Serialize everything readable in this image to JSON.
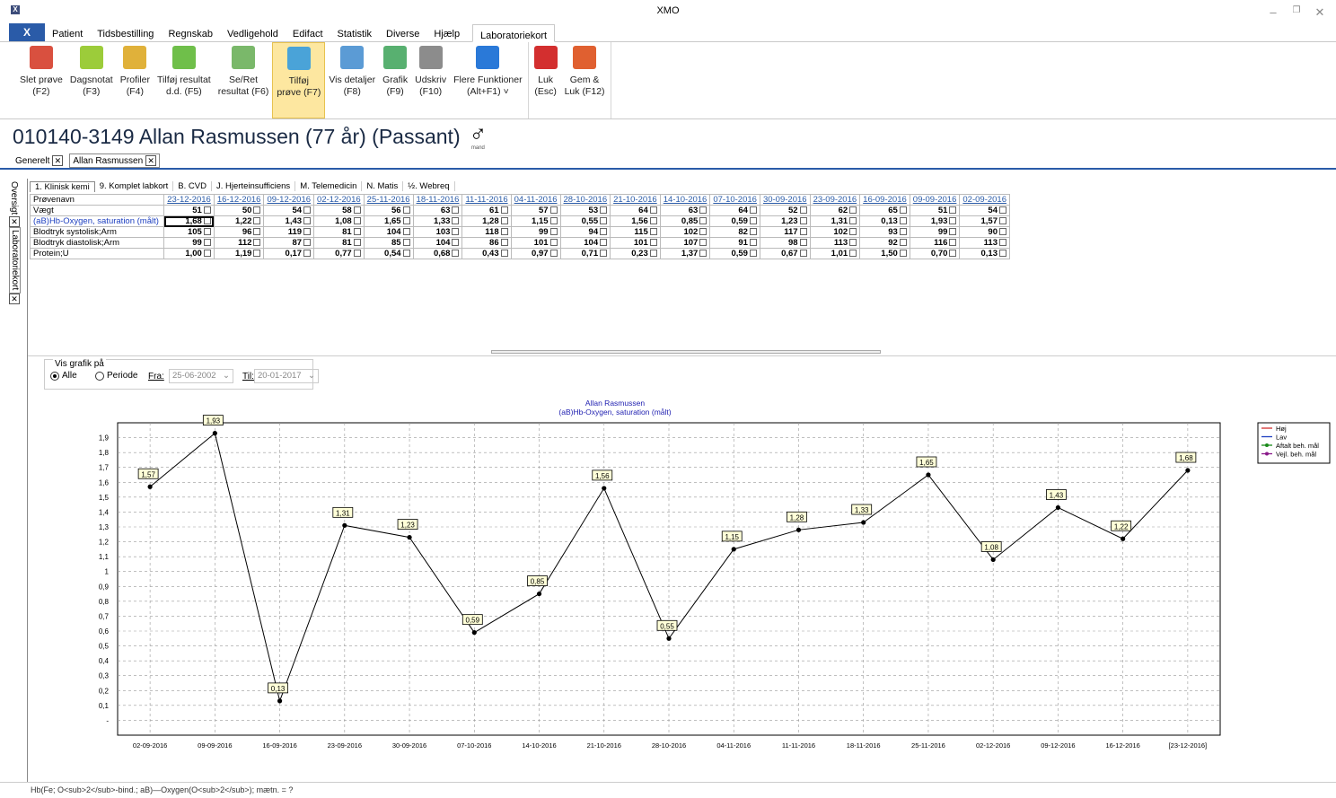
{
  "app": {
    "title": "XMO",
    "icon_letter": "X"
  },
  "menu": {
    "file_label": "X",
    "tabs": [
      "Patient",
      "Tidsbestilling",
      "Regnskab",
      "Vedligehold",
      "Edifact",
      "Statistik",
      "Diverse",
      "Hjælp"
    ],
    "active_tab": "Laboratoriekort"
  },
  "ribbon": {
    "buttons": [
      {
        "l1": "Slet prøve",
        "l2": "(F2)",
        "icon": "erase-icon",
        "color": "#d9503f"
      },
      {
        "l1": "Dagsnotat",
        "l2": "(F3)",
        "icon": "pencil-icon",
        "color": "#9ccc3a"
      },
      {
        "l1": "Profiler",
        "l2": "(F4)",
        "icon": "flask-icon",
        "color": "#e0b13a"
      },
      {
        "l1": "Tilføj resultat",
        "l2": "d.d. (F5)",
        "icon": "add-table-icon",
        "color": "#6fbf4a"
      },
      {
        "l1": "Se/Ret",
        "l2": "resultat (F6)",
        "icon": "edit-icon",
        "color": "#7ab86a"
      },
      {
        "l1": "Tilføj",
        "l2": "prøve (F7)",
        "icon": "add-sample-icon",
        "color": "#4aa3d8",
        "active": true
      },
      {
        "l1": "Vis detaljer",
        "l2": "(F8)",
        "icon": "magnifier-icon",
        "color": "#5b9bd5"
      },
      {
        "l1": "Grafik",
        "l2": "(F9)",
        "icon": "picture-icon",
        "color": "#58b070"
      },
      {
        "l1": "Udskriv",
        "l2": "(F10)",
        "icon": "printer-icon",
        "color": "#8c8c8c"
      },
      {
        "l1": "Flere Funktioner",
        "l2": "(Alt+F1) ˅",
        "icon": "fast-forward-icon",
        "color": "#2a79d8"
      }
    ],
    "close_buttons": [
      {
        "l1": "Luk",
        "l2": "(Esc)",
        "icon": "close-icon",
        "color": "#d32f2f"
      },
      {
        "l1": "Gem &",
        "l2": "Luk (F12)",
        "icon": "save-close-icon",
        "color": "#e06030"
      }
    ]
  },
  "patient": {
    "header": "010140-3149 Allan Rasmussen (77 år) (Passant)",
    "gender_symbol": "♂",
    "gender_label": "mand"
  },
  "doc_tabs": [
    "Generelt",
    "Allan Rasmussen"
  ],
  "left_rail": [
    "Oversigt",
    "Laboratoriekort"
  ],
  "sub_tabs": [
    "1. Klinisk kemi",
    "9. Komplet labkort",
    "B. CVD",
    "J. Hjerteinsufficiens",
    "M. Telemedicin",
    "N. Matis",
    "½. Webreq"
  ],
  "grid": {
    "name_header": "Prøvenavn",
    "dates": [
      "23-12-2016",
      "16-12-2016",
      "09-12-2016",
      "02-12-2016",
      "25-11-2016",
      "18-11-2016",
      "11-11-2016",
      "04-11-2016",
      "28-10-2016",
      "21-10-2016",
      "14-10-2016",
      "07-10-2016",
      "30-09-2016",
      "23-09-2016",
      "16-09-2016",
      "09-09-2016",
      "02-09-2016"
    ],
    "rows": [
      {
        "name": "Vægt",
        "values": [
          "51",
          "50",
          "54",
          "58",
          "56",
          "63",
          "61",
          "57",
          "53",
          "64",
          "63",
          "64",
          "52",
          "62",
          "65",
          "51",
          "54"
        ]
      },
      {
        "name": "(aB)Hb-Oxygen, saturation (målt)",
        "link": true,
        "values": [
          "1,68",
          "1,22",
          "1,43",
          "1,08",
          "1,65",
          "1,33",
          "1,28",
          "1,15",
          "0,55",
          "1,56",
          "0,85",
          "0,59",
          "1,23",
          "1,31",
          "0,13",
          "1,93",
          "1,57"
        ]
      },
      {
        "name": "Blodtryk systolisk;Arm",
        "values": [
          "105",
          "96",
          "119",
          "81",
          "104",
          "103",
          "118",
          "99",
          "94",
          "115",
          "102",
          "82",
          "117",
          "102",
          "93",
          "99",
          "90"
        ]
      },
      {
        "name": "Blodtryk diastolisk;Arm",
        "values": [
          "99",
          "112",
          "87",
          "81",
          "85",
          "104",
          "86",
          "101",
          "104",
          "101",
          "107",
          "91",
          "98",
          "113",
          "92",
          "116",
          "113"
        ]
      },
      {
        "name": "Protein;U",
        "values": [
          "1,00",
          "1,19",
          "0,17",
          "0,77",
          "0,54",
          "0,68",
          "0,43",
          "0,97",
          "0,71",
          "0,23",
          "1,37",
          "0,59",
          "0,67",
          "1,01",
          "1,50",
          "0,70",
          "0,13"
        ]
      }
    ]
  },
  "graph_controls": {
    "group_label": "Vis grafik på",
    "all_label": "Alle",
    "period_label": "Periode",
    "from_label": "Fra:",
    "from_value": "25-06-2002",
    "to_label": "Til:",
    "to_value": "20-01-2017"
  },
  "chart_data": {
    "type": "line",
    "title": "Allan Rasmussen",
    "subtitle": "(aB)Hb-Oxygen, saturation (målt)",
    "categories": [
      "02-09-2016",
      "09-09-2016",
      "16-09-2016",
      "23-09-2016",
      "30-09-2016",
      "07-10-2016",
      "14-10-2016",
      "21-10-2016",
      "28-10-2016",
      "04-11-2016",
      "11-11-2016",
      "18-11-2016",
      "25-11-2016",
      "02-12-2016",
      "09-12-2016",
      "16-12-2016",
      "[23-12-2016]"
    ],
    "values": [
      1.57,
      1.93,
      0.13,
      1.31,
      1.23,
      0.59,
      0.85,
      1.56,
      0.55,
      1.15,
      1.28,
      1.33,
      1.65,
      1.08,
      1.43,
      1.22,
      1.68
    ],
    "data_labels": [
      "1,57",
      "1,93",
      "0,13",
      "1,31",
      "1,23",
      "0,59",
      "0,85",
      "1,56",
      "0,55",
      "1,15",
      "1,28",
      "1,33",
      "1,65",
      "1,08",
      "1,43",
      "1,22",
      "1,68"
    ],
    "ylim": [
      -0.1,
      2.0
    ],
    "yticks": [
      "-",
      "0,1",
      "0,2",
      "0,3",
      "0,4",
      "0,5",
      "0,6",
      "0,7",
      "0,8",
      "0,9",
      "1",
      "1,1",
      "1,2",
      "1,3",
      "1,4",
      "1,5",
      "1,6",
      "1,7",
      "1,8",
      "1,9"
    ],
    "grid": true,
    "legend": [
      {
        "name": "Høj",
        "color": "#d32f2f"
      },
      {
        "name": "Lav",
        "color": "#1e40c0"
      },
      {
        "name": "Aftalt beh. mål",
        "color": "#1a8a1a"
      },
      {
        "name": "Vejl. beh. mål",
        "color": "#8a1a8a"
      }
    ],
    "legend_position": "top-right"
  },
  "status": {
    "text": "Hb(Fe; O<sub>2</sub>-bind.; aB)—Oxygen(O<sub>2</sub>); mætn. = ?"
  }
}
